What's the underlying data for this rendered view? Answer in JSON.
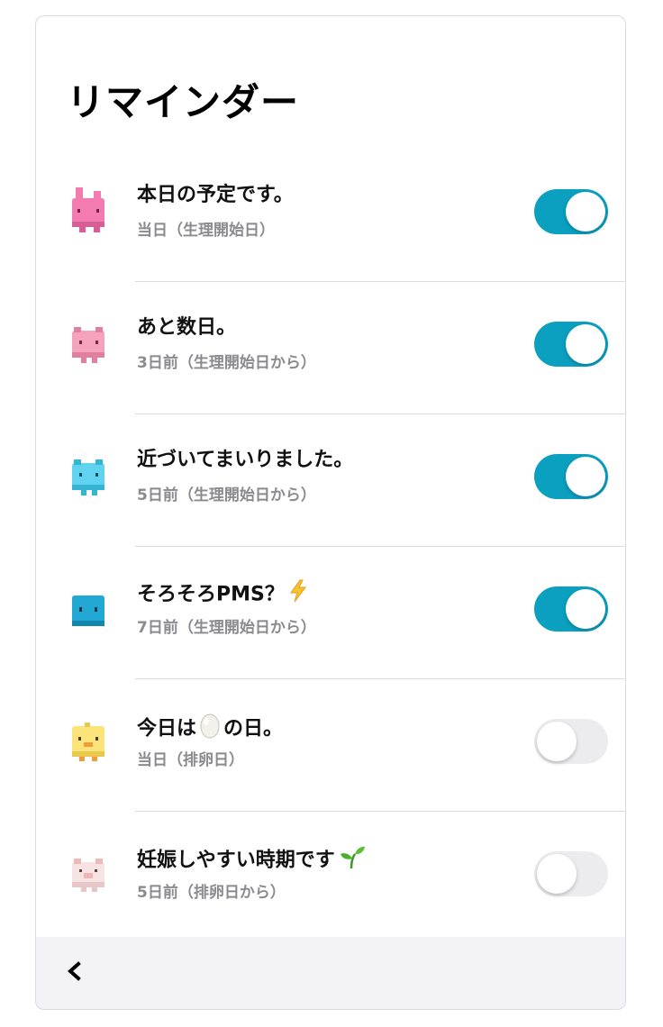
{
  "header": {
    "title": "リマインダー"
  },
  "reminders": [
    {
      "title": "本日の予定です。",
      "subtitle": "当日（生理開始日）",
      "enabled": true,
      "avatar": "pink-rabbit-icon",
      "avatar_color": "#f27bb0"
    },
    {
      "title": "あと数日。",
      "subtitle": "3日前（生理開始日から）",
      "enabled": true,
      "avatar": "pink-pig-icon",
      "avatar_color": "#f5a3bd"
    },
    {
      "title": "近づいてまいりました。",
      "subtitle": "5日前（生理開始日から）",
      "enabled": true,
      "avatar": "light-blue-pig-icon",
      "avatar_color": "#5fd3ef"
    },
    {
      "title": "そろそろPMS？",
      "title_emoji": "lightning-icon",
      "subtitle": "7日前（生理開始日から）",
      "enabled": true,
      "avatar": "blue-cube-icon",
      "avatar_color": "#21a9d3"
    },
    {
      "title_before": "今日は",
      "title_emoji": "egg-icon",
      "title_after": "の日。",
      "subtitle": "当日（排卵日）",
      "enabled": false,
      "avatar": "yellow-chick-icon",
      "avatar_color": "#fbe57a"
    },
    {
      "title": "妊娠しやすい時期です",
      "title_emoji": "sprout-icon",
      "subtitle": "5日前（排卵日から）",
      "enabled": false,
      "avatar": "white-pig-icon",
      "avatar_color": "#f7e3e3"
    }
  ],
  "footer": {
    "back_icon": "chevron-left-icon"
  },
  "colors": {
    "toggle_on": "#0b9fc0",
    "toggle_off": "#ececef",
    "subtitle": "#8a8a8f",
    "footer_bg": "#f2f2f7"
  }
}
